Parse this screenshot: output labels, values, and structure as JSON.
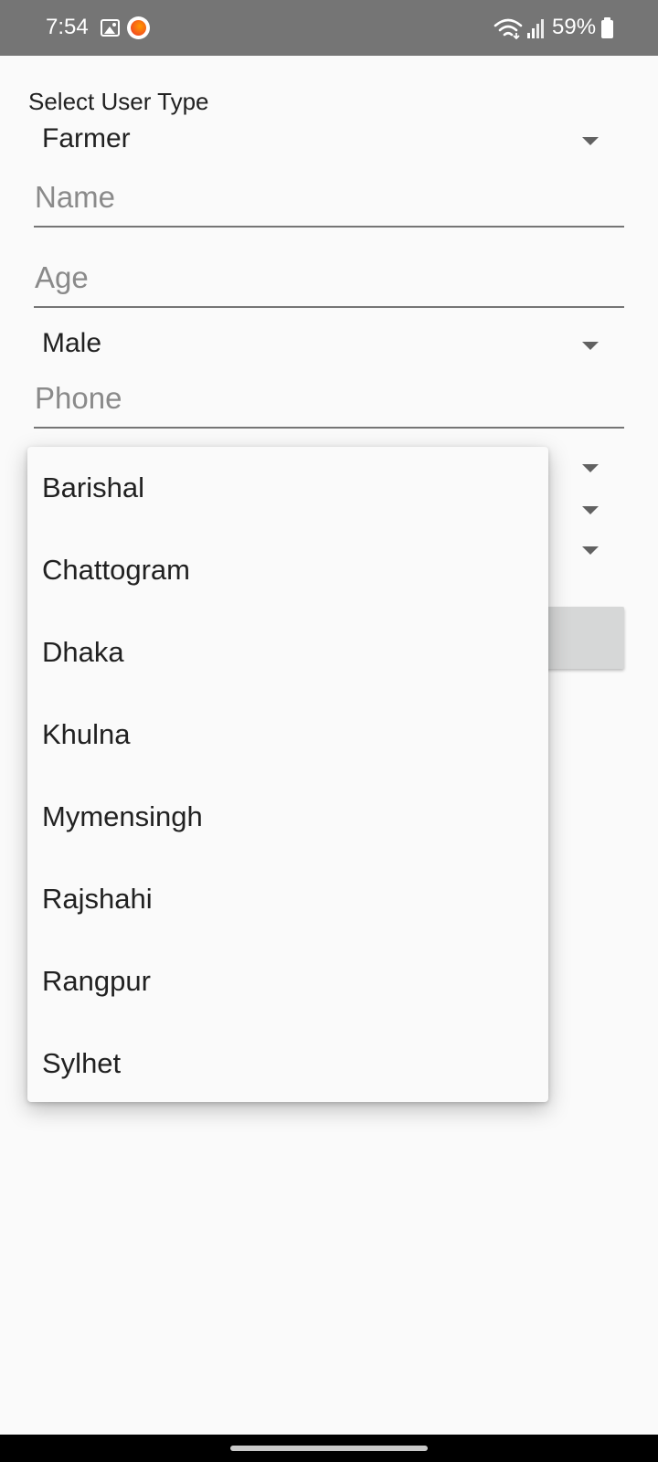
{
  "status_bar": {
    "time": "7:54",
    "battery": "59%",
    "icons": [
      "image-icon",
      "app-notification-icon",
      "wifi-icon",
      "signal-icon",
      "battery-icon"
    ]
  },
  "form": {
    "user_type_label": "Select User Type",
    "user_type_value": "Farmer",
    "name_placeholder": "Name",
    "age_placeholder": "Age",
    "gender_value": "Male",
    "phone_placeholder": "Phone"
  },
  "dropdown": {
    "items": [
      "Barishal",
      "Chattogram",
      "Dhaka",
      "Khulna",
      "Mymensingh",
      "Rajshahi",
      "Rangpur",
      "Sylhet"
    ]
  },
  "colors": {
    "status_bar": "#757575",
    "background": "#fafafa",
    "underline": "#757575",
    "hint_text": "#8a8a8a"
  }
}
